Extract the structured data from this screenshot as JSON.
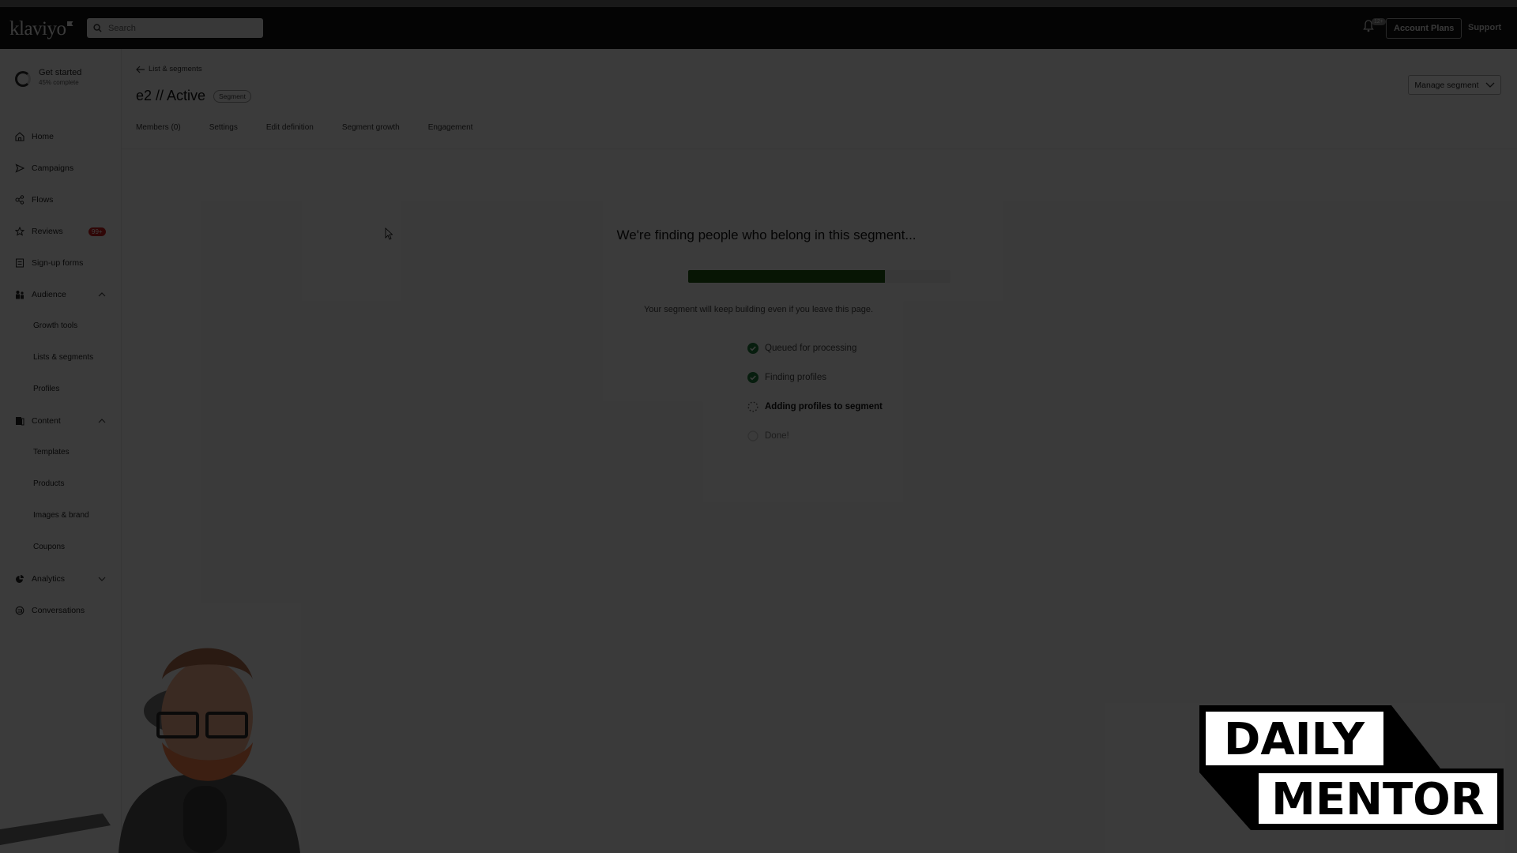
{
  "topbar": {
    "logo": "klaviyo",
    "search_placeholder": "Search",
    "notification_count": "12+",
    "account_button": "Account Plans",
    "support_link": "Support"
  },
  "sidebar": {
    "get_started": {
      "title": "Get started",
      "subtitle": "45% complete",
      "progress_percent": 45
    },
    "items": [
      {
        "label": "Home",
        "icon": "home-icon"
      },
      {
        "label": "Campaigns",
        "icon": "send-icon"
      },
      {
        "label": "Flows",
        "icon": "flows-icon"
      },
      {
        "label": "Reviews",
        "icon": "star-icon",
        "badge": "99+"
      },
      {
        "label": "Sign-up forms",
        "icon": "form-icon"
      },
      {
        "label": "Audience",
        "icon": "audience-icon",
        "expanded": true,
        "children": [
          "Growth tools",
          "Lists & segments",
          "Profiles"
        ]
      },
      {
        "label": "Content",
        "icon": "content-icon",
        "expanded": true,
        "children": [
          "Templates",
          "Products",
          "Images & brand",
          "Coupons"
        ]
      },
      {
        "label": "Analytics",
        "icon": "analytics-icon",
        "expanded": false
      },
      {
        "label": "Conversations",
        "icon": "conversations-icon"
      }
    ]
  },
  "header": {
    "breadcrumb": "List & segments",
    "title": "e2 // Active",
    "tag": "Segment",
    "manage_button": "Manage segment",
    "tabs": [
      "Members (0)",
      "Settings",
      "Edit definition",
      "Segment growth",
      "Engagement"
    ]
  },
  "status": {
    "heading": "We're finding people who belong in this segment...",
    "progress_percent": 75,
    "note": "Your segment will keep building even if you leave this page.",
    "steps": [
      {
        "label": "Queued for processing",
        "state": "done"
      },
      {
        "label": "Finding profiles",
        "state": "done"
      },
      {
        "label": "Adding profiles to segment",
        "state": "in-progress"
      },
      {
        "label": "Done!",
        "state": "pending"
      }
    ]
  },
  "overlay": {
    "brand_logo_lines": [
      "DAILY",
      "MENTOR"
    ]
  },
  "colors": {
    "progress_fill": "#1f5a12",
    "badge_red": "#c81f1f",
    "topbar_bg": "#111111"
  }
}
